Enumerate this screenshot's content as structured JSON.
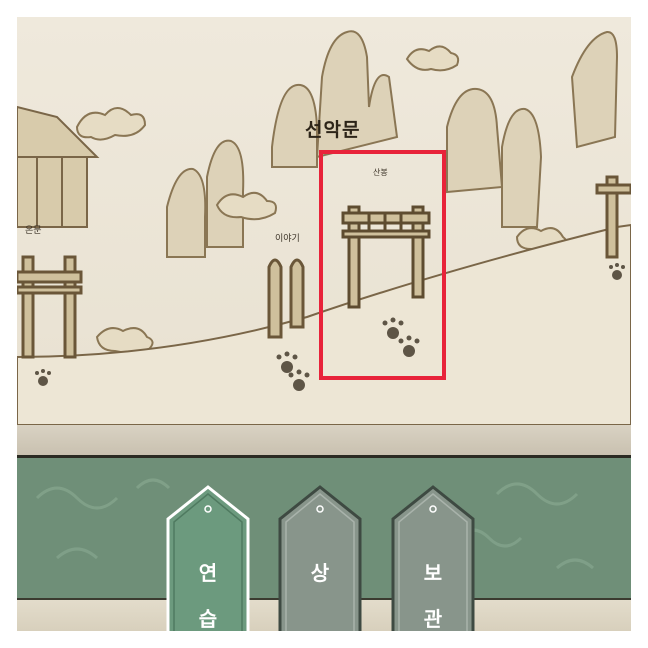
{
  "map": {
    "title": "선악문",
    "labels": {
      "onmun": "온문",
      "iyagi": "이야기",
      "sansung": "산봉"
    }
  },
  "tabs": [
    {
      "chars": [
        "연",
        "습"
      ],
      "color": "#6c9a7e",
      "active": true
    },
    {
      "chars": [
        "상",
        ""
      ],
      "color": "#88958b",
      "active": false
    },
    {
      "chars": [
        "보",
        "관"
      ],
      "color": "#88958b",
      "active": false
    }
  ],
  "colors": {
    "highlight": "#e8233a",
    "panel": "#6f8f78"
  }
}
